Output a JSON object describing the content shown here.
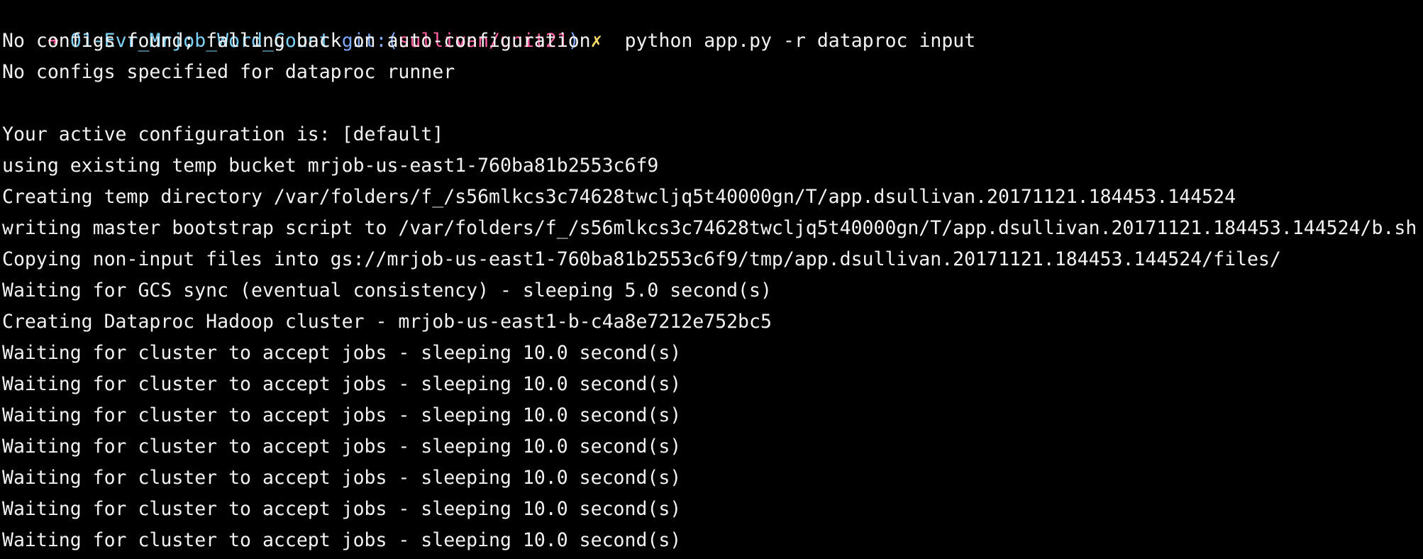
{
  "terminal": {
    "prompt": {
      "arrow": "➜",
      "directory": "01-Evr_Mrjob_Word_Count",
      "git_label": "git:(",
      "branch": "sullivan/unit21",
      "git_close": ")",
      "dirty_marker": "✗",
      "command": "python app.py -r dataproc input"
    },
    "output": [
      "No configs found; falling back on auto-configuration",
      "No configs specified for dataproc runner",
      "",
      "Your active configuration is: [default]",
      "using existing temp bucket mrjob-us-east1-760ba81b2553c6f9",
      "Creating temp directory /var/folders/f_/s56mlkcs3c74628twcljq5t40000gn/T/app.dsullivan.20171121.184453.144524",
      "writing master bootstrap script to /var/folders/f_/s56mlkcs3c74628twcljq5t40000gn/T/app.dsullivan.20171121.184453.144524/b.sh",
      "Copying non-input files into gs://mrjob-us-east1-760ba81b2553c6f9/tmp/app.dsullivan.20171121.184453.144524/files/",
      "Waiting for GCS sync (eventual consistency) - sleeping 5.0 second(s)",
      "Creating Dataproc Hadoop cluster - mrjob-us-east1-b-c4a8e7212e752bc5",
      "Waiting for cluster to accept jobs - sleeping 10.0 second(s)",
      "Waiting for cluster to accept jobs - sleeping 10.0 second(s)",
      "Waiting for cluster to accept jobs - sleeping 10.0 second(s)",
      "Waiting for cluster to accept jobs - sleeping 10.0 second(s)",
      "Waiting for cluster to accept jobs - sleeping 10.0 second(s)",
      "Waiting for cluster to accept jobs - sleeping 10.0 second(s)",
      "Waiting for cluster to accept jobs - sleeping 10.0 second(s)"
    ],
    "colors": {
      "background": "#000000",
      "text": "#f2f2f2",
      "arrow": "#ff5fa2",
      "directory": "#7fd3f7",
      "git": "#7fa7f7",
      "branch": "#ff5fa2",
      "dirty": "#ffe066"
    }
  }
}
